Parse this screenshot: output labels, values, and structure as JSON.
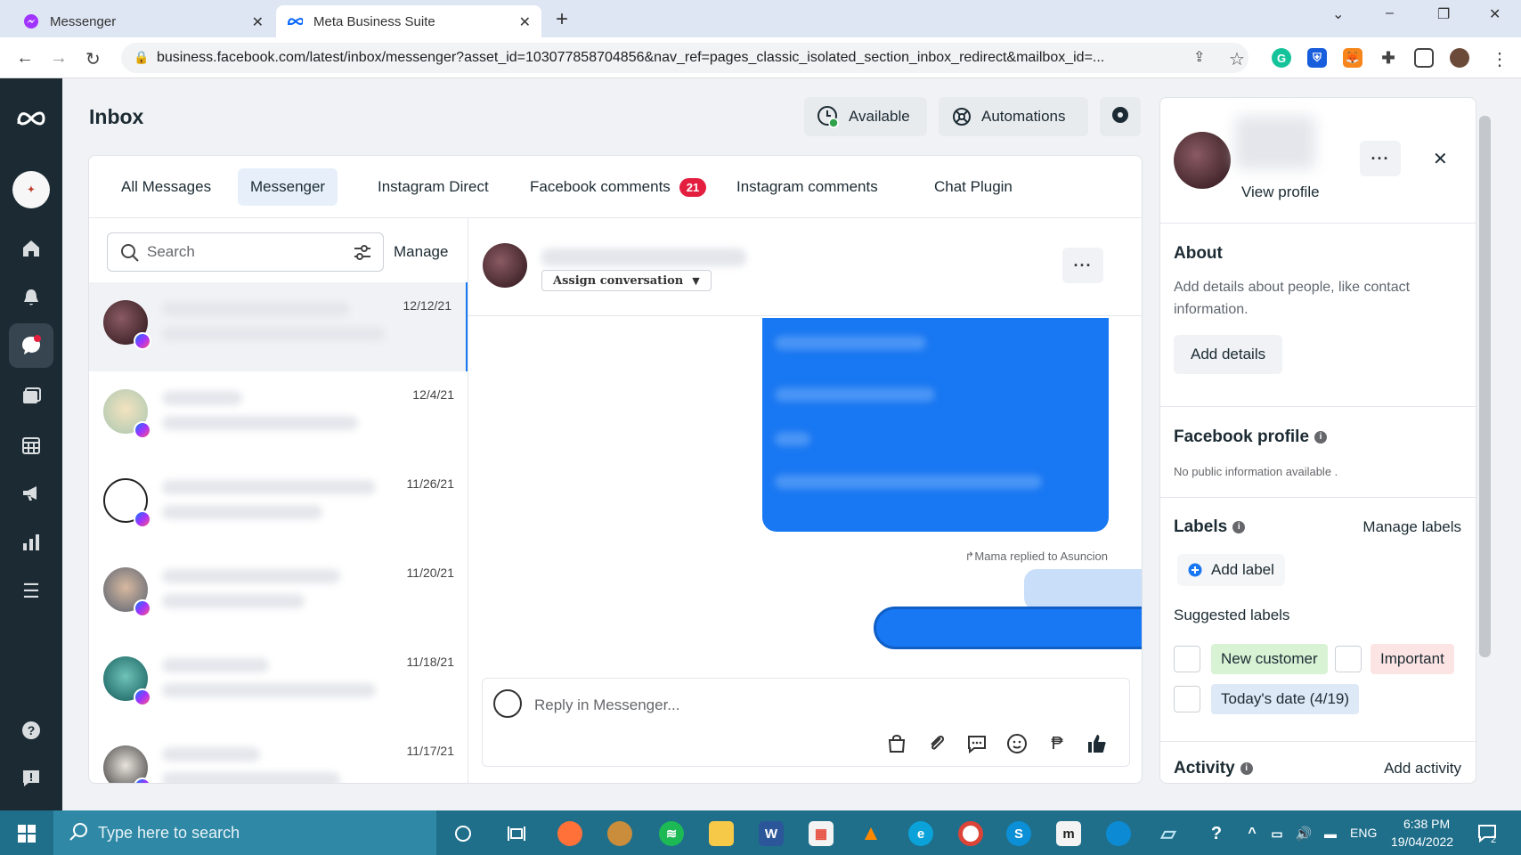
{
  "browser": {
    "tabs": [
      {
        "title": "Messenger"
      },
      {
        "title": "Meta Business Suite"
      }
    ],
    "url": "business.facebook.com/latest/inbox/messenger?asset_id=103077858704856&nav_ref=pages_classic_isolated_section_inbox_redirect&mailbox_id=..."
  },
  "header": {
    "title": "Inbox",
    "available_label": "Available",
    "automations_label": "Automations"
  },
  "inbox_tabs": [
    {
      "label": "All Messages"
    },
    {
      "label": "Messenger"
    },
    {
      "label": "Instagram Direct"
    },
    {
      "label": "Facebook comments",
      "badge": "21"
    },
    {
      "label": "Instagram comments"
    },
    {
      "label": "Chat Plugin"
    }
  ],
  "list": {
    "search_placeholder": "Search",
    "manage_label": "Manage",
    "conversations": [
      {
        "date": "12/12/21"
      },
      {
        "date": "12/4/21"
      },
      {
        "date": "11/26/21"
      },
      {
        "date": "11/20/21"
      },
      {
        "date": "11/18/21"
      },
      {
        "date": "11/17/21"
      }
    ]
  },
  "chat": {
    "assign_label": "Assign conversation",
    "replied_note": "↱Mama replied to Asuncion",
    "composer_placeholder": "Reply in Messenger..."
  },
  "profile": {
    "view_profile": "View profile",
    "about_title": "About",
    "about_text": "Add details about people, like contact information.",
    "add_details": "Add details",
    "fb_profile_title": "Facebook profile",
    "fb_profile_text": "No public information available .",
    "labels_title": "Labels",
    "manage_labels": "Manage labels",
    "add_label": "Add label",
    "suggested_title": "Suggested labels",
    "suggested": [
      "New customer",
      "Important",
      "Today's date (4/19)"
    ],
    "activity_title": "Activity",
    "add_activity": "Add activity"
  },
  "taskbar": {
    "search_placeholder": "Type here to search",
    "lang": "ENG",
    "time": "6:38 PM",
    "date": "19/04/2022",
    "notif_count": "2"
  },
  "colors": {
    "accent": "#1877f2",
    "sidebar": "#1c2b33",
    "badge": "#e41e3f",
    "new_customer_bg": "#d8f2d4",
    "important_bg": "#fde4e4",
    "todays_date_bg": "#dde9f6"
  }
}
